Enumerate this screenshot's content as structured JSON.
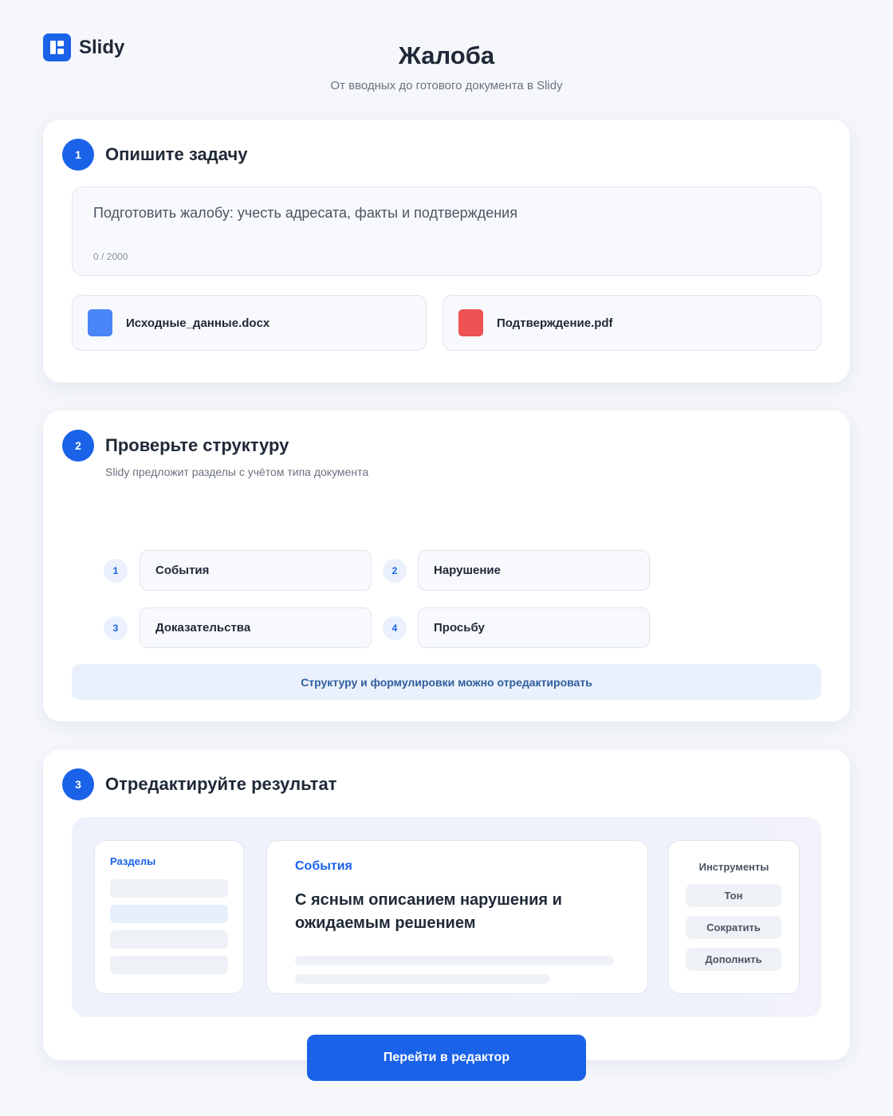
{
  "brand": {
    "name": "Slidy"
  },
  "header": {
    "title": "Жалоба",
    "subtitle": "От вводных до готового документа в Slidy"
  },
  "step1": {
    "number": "1",
    "title": "Опишите задачу",
    "task_text": "Подготовить жалобу: учесть адресата, факты и подтверждения",
    "char_count": "0 / 2000",
    "files": [
      {
        "name": "Исходные_данные.docx",
        "icon": "docx-file-icon",
        "color": "#4a86f7"
      },
      {
        "name": "Подтверждение.pdf",
        "icon": "pdf-file-icon",
        "color": "#ee5253"
      }
    ]
  },
  "step2": {
    "number": "2",
    "title": "Проверьте структуру",
    "description": "Slidy предложит разделы с учётом типа документа",
    "sections": [
      {
        "num": "1",
        "label": "События"
      },
      {
        "num": "2",
        "label": "Нарушение"
      },
      {
        "num": "3",
        "label": "Доказательства"
      },
      {
        "num": "4",
        "label": "Просьбу"
      }
    ],
    "note": "Структуру и формулировки можно отредактировать"
  },
  "step3": {
    "number": "3",
    "title": "Отредактируйте результат",
    "sections_panel": {
      "label": "Разделы"
    },
    "content_panel": {
      "section_label": "События",
      "heading": "С ясным описанием нарушения и ожидаемым решением"
    },
    "tools_panel": {
      "label": "Инструменты",
      "tools": [
        "Тон",
        "Сократить",
        "Дополнить"
      ]
    }
  },
  "cta": {
    "label": "Перейти в редактор"
  },
  "colors": {
    "accent": "#1a62e8",
    "background": "#f5f7fb"
  }
}
